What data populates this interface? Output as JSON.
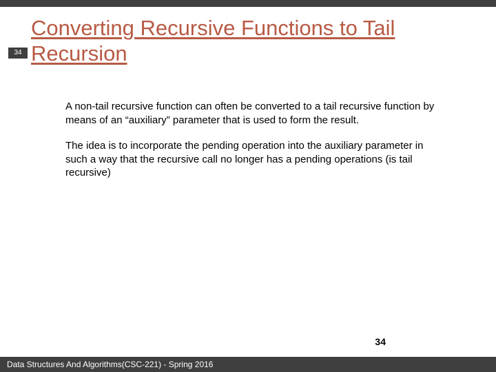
{
  "slide": {
    "top_badge_number": "34",
    "title": "Converting Recursive Functions to Tail Recursion",
    "paragraphs": {
      "p1": "A non-tail recursive function can often be converted to a tail recursive function by means of an “auxiliary” parameter that is used to form the result.",
      "p2": "The idea is to incorporate the pending operation into the auxiliary parameter in such a way that the recursive call no longer has a pending operations (is tail recursive)"
    },
    "page_number_right": "34",
    "footer": "Data Structures And Algorithms(CSC-221) - Spring 2016"
  }
}
